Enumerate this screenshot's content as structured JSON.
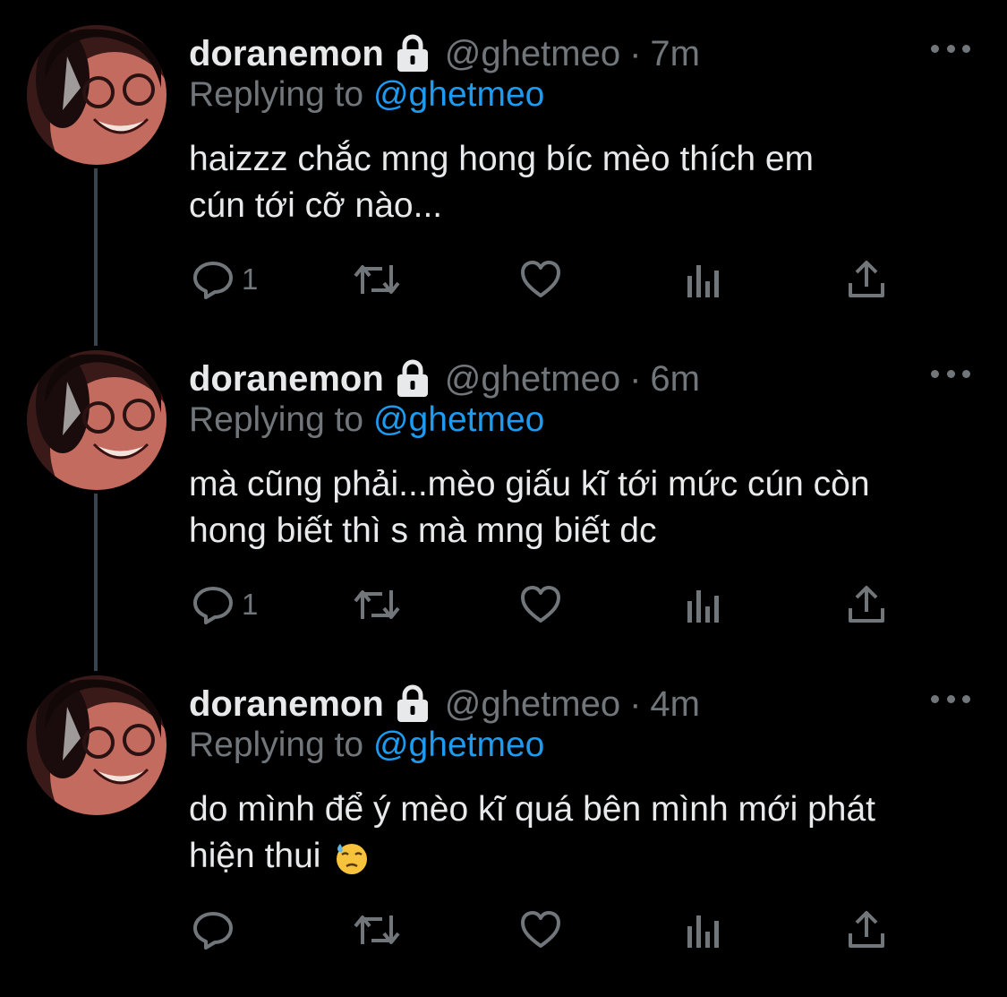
{
  "colors": {
    "background": "#000000",
    "text": "#e7e9ea",
    "muted": "#71767b",
    "link": "#1d9bf0",
    "thread_line": "#38444d"
  },
  "tweets": [
    {
      "display_name": "doranemon",
      "handle": "@ghetmeo",
      "separator": "·",
      "time": "7m",
      "replying_label": "Replying to",
      "replying_to": "@ghetmeo",
      "text_line1": "haizzz chắc mng hong bíc mèo thích em",
      "text_line2": "cún tới cỡ nào...",
      "reply_count": "1",
      "icons": [
        "lock-icon",
        "more-icon",
        "reply-icon",
        "retweet-icon",
        "like-icon",
        "analytics-icon",
        "share-icon"
      ]
    },
    {
      "display_name": "doranemon",
      "handle": "@ghetmeo",
      "separator": "·",
      "time": "6m",
      "replying_label": "Replying to",
      "replying_to": "@ghetmeo",
      "text_line1": "mà cũng phải...mèo giấu kĩ tới mức cún còn",
      "text_line2": "hong biết thì s mà mng biết dc",
      "reply_count": "1"
    },
    {
      "display_name": "doranemon",
      "handle": "@ghetmeo",
      "separator": "·",
      "time": "4m",
      "replying_label": "Replying to",
      "replying_to": "@ghetmeo",
      "text_line1": "do mình để ý mèo kĩ quá bên mình mới phát",
      "text_line2": "hiện thui",
      "emoji": "downcast-face-with-sweat-emoji",
      "reply_count": ""
    }
  ]
}
